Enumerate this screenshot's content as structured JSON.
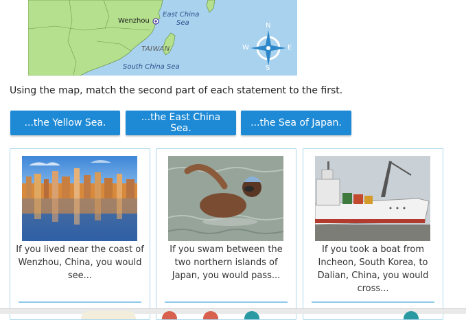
{
  "map": {
    "city_label": "Wenzhou",
    "sea_label_line1": "East China",
    "sea_label_line2": "Sea",
    "taiwan_label": "TAIWAN",
    "south_sea_label": "South China Sea",
    "compass": {
      "n": "N",
      "s": "S",
      "e": "E",
      "w": "W"
    },
    "colors": {
      "sea": "#a9d2ee",
      "land": "#b5e08d",
      "border": "#6e9a52",
      "compass": "#2d87c9"
    }
  },
  "instruction": "Using the map, match the second part of each statement to the first.",
  "answers": [
    {
      "label": "...the Yellow Sea."
    },
    {
      "label": "...the East China Sea."
    },
    {
      "label": "...the Sea of Japan."
    }
  ],
  "cards": [
    {
      "text": "If you lived near the coast of Wenzhou, China, you would see...",
      "image": "city-skyline-reflection"
    },
    {
      "text": "If you swam between the two northern islands of Japan, you would pass...",
      "image": "swimmer-in-sea"
    },
    {
      "text": "If you took a boat from Incheon, South Korea, to Dalian, China, you would cross...",
      "image": "cargo-ship-at-dock"
    }
  ],
  "colors": {
    "button": "#1e8ad6",
    "card_border": "#a9d7ee"
  }
}
